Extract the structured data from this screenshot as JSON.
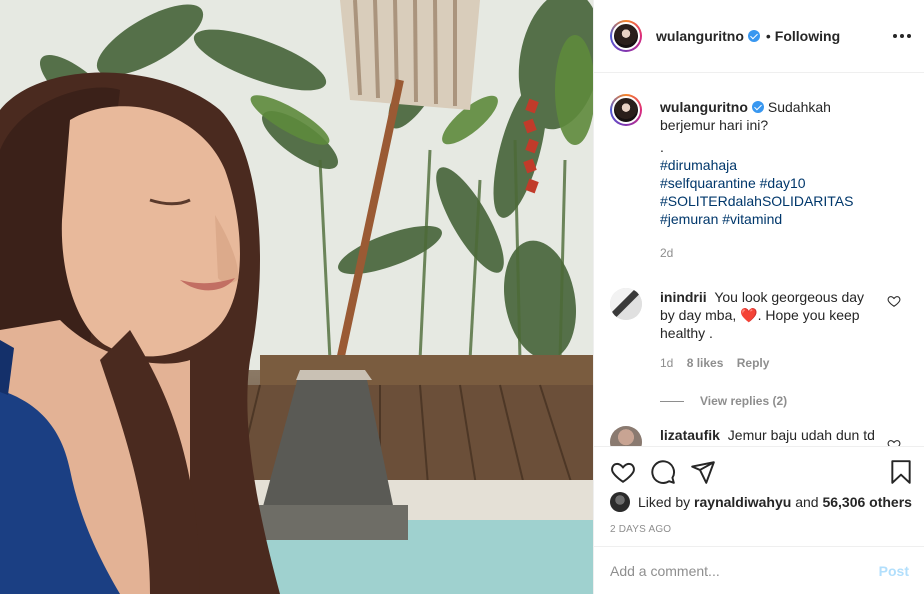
{
  "post": {
    "author": "wulanguritno",
    "verified": true,
    "follow_status": "Following",
    "separator": "•"
  },
  "caption": {
    "author": "wulanguritno",
    "text": "Sudahkah berjemur hari ini?",
    "dot": ".",
    "hashtags": [
      "#dirumahaja",
      "#selfquarantine #day10",
      "#SOLITERdalahSOLIDARITAS",
      "#jemuran #vitamind"
    ],
    "age": "2d"
  },
  "comments": [
    {
      "author": "inindrii",
      "text_before": "You look georgeous day by day mba,",
      "emoji": "❤️",
      "text_after": ". Hope you keep healthy .",
      "age": "1d",
      "likes": "8 likes",
      "reply_label": "Reply",
      "view_replies": "View replies (2)"
    },
    {
      "author": "lizataufik",
      "text": "Jemur baju udah dun td pagi",
      "emoji": "😂"
    }
  ],
  "likes": {
    "prefix": "Liked by",
    "user": "raynaldiwahyu",
    "and": "and",
    "count": "56,306 others"
  },
  "timestamp": "2 DAYS AGO",
  "comment_box": {
    "placeholder": "Add a comment...",
    "post_label": "Post"
  },
  "colors": {
    "link": "#00376b",
    "muted": "#8e8e8e",
    "verified": "#3897f0",
    "post_disabled": "#b2dffc"
  }
}
